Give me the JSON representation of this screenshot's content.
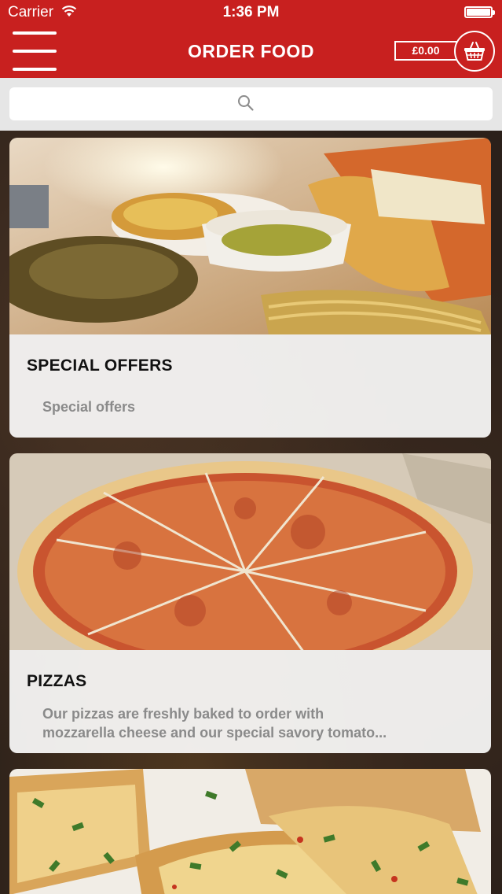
{
  "status_bar": {
    "carrier": "Carrier",
    "time": "1:36 PM"
  },
  "header": {
    "title": "ORDER FOOD",
    "cart_total": "£0.00",
    "accent_color": "#c8201f"
  },
  "search": {
    "placeholder": ""
  },
  "categories": [
    {
      "title": "SPECIAL OFFERS",
      "description": [
        "Special offers"
      ]
    },
    {
      "title": "PIZZAS",
      "description": [
        "Our pizzas are freshly baked to order with",
        "mozzarella cheese and our special savory tomato..."
      ]
    },
    {
      "title": "",
      "description": []
    }
  ]
}
